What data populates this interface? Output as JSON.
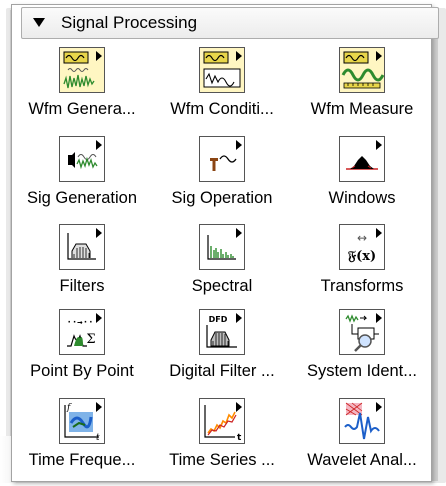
{
  "palette": {
    "title": "Signal Processing",
    "items": [
      {
        "label": "Wfm Genera...",
        "icon": "waveform-generation-icon"
      },
      {
        "label": "Wfm Conditi...",
        "icon": "waveform-conditioning-icon"
      },
      {
        "label": "Wfm Measure",
        "icon": "waveform-measurement-icon"
      },
      {
        "label": "Sig Generation",
        "icon": "signal-generation-icon"
      },
      {
        "label": "Sig Operation",
        "icon": "signal-operation-icon"
      },
      {
        "label": "Windows",
        "icon": "windows-icon"
      },
      {
        "label": "Filters",
        "icon": "filters-icon"
      },
      {
        "label": "Spectral",
        "icon": "spectral-icon"
      },
      {
        "label": "Transforms",
        "icon": "transforms-icon"
      },
      {
        "label": "Point By Point",
        "icon": "point-by-point-icon"
      },
      {
        "label": "Digital Filter ...",
        "icon": "digital-filter-icon"
      },
      {
        "label": "System Ident...",
        "icon": "system-identification-icon"
      },
      {
        "label": "Time Freque...",
        "icon": "time-frequency-icon"
      },
      {
        "label": "Time Series ...",
        "icon": "time-series-icon"
      },
      {
        "label": "Wavelet Anal...",
        "icon": "wavelet-analysis-icon"
      }
    ],
    "icon_glyphs": {
      "transform_arrows": "↔",
      "transform_fx": "𝔉(x)",
      "dfd_text": "DFD",
      "pbp_arrows": "··→··",
      "pbp_sigma": "Σ",
      "tf_f": "f",
      "tf_t": "t",
      "ts_t": "t"
    },
    "colors": {
      "green": "#2e8b2e",
      "dark_green": "#1a6b1a",
      "red": "#cc2222",
      "blue": "#1c5fc9",
      "yellow": "#e8d64a",
      "pale_yellow": "#fff6c2"
    }
  }
}
